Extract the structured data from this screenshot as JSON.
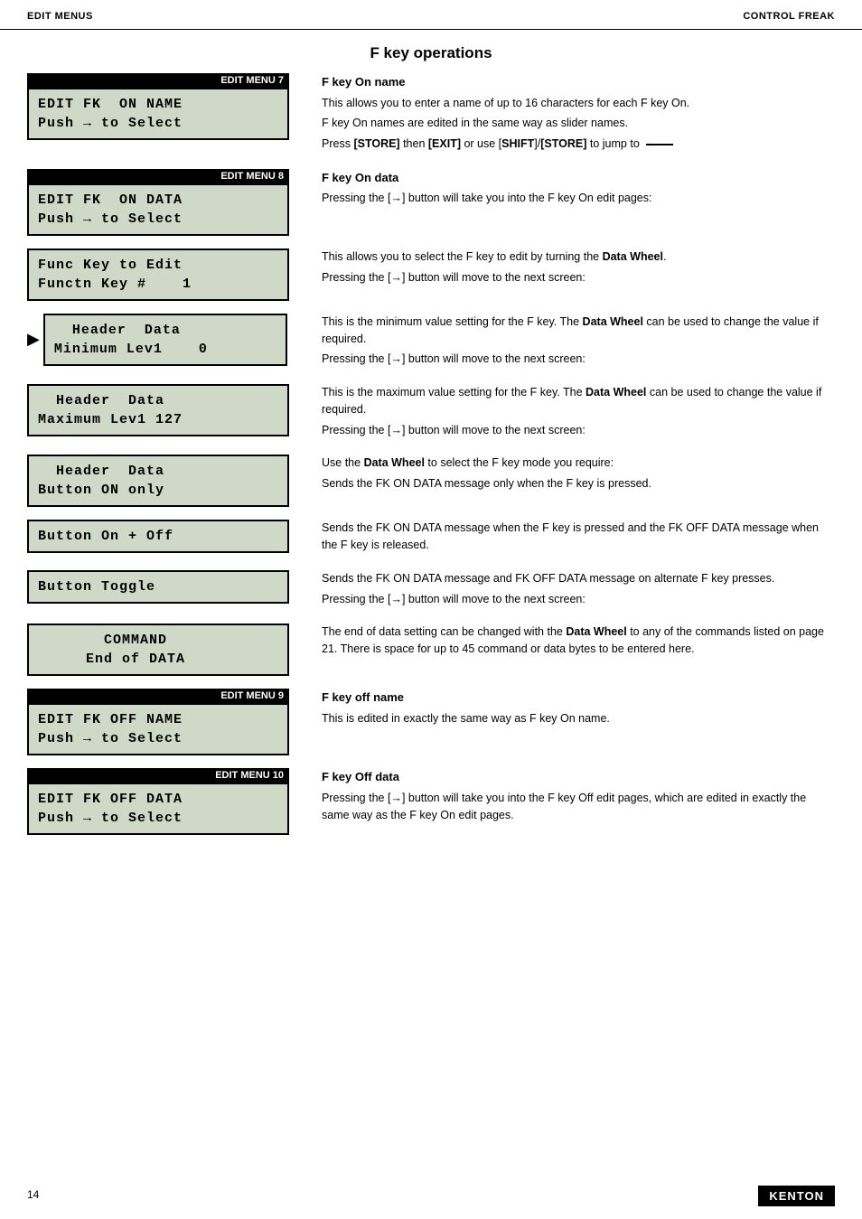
{
  "header": {
    "left": "EDIT MENUS",
    "right": "CONTROL FREAK"
  },
  "section_title": "F key operations",
  "page_number": "14",
  "brand": "KENTON",
  "rows": [
    {
      "id": "edit-menu-7",
      "menu_label": "EDIT MENU 7",
      "lcd_lines": [
        "EDIT FK  ON NAME",
        "Push → to Select"
      ],
      "heading": "F key On name",
      "has_pointer": false,
      "paragraphs": [
        "This allows you to enter a name of up to 16 characters for each F key On.",
        "F key On names are edited in the same way as slider names.",
        "Press [STORE] then [EXIT] or use [SHIFT]/[STORE] to jump to —"
      ]
    },
    {
      "id": "edit-menu-8",
      "menu_label": "EDIT MENU 8",
      "lcd_lines": [
        "EDIT FK  ON DATA",
        "Push → to Select"
      ],
      "heading": "F key On data",
      "has_pointer": false,
      "paragraphs": [
        "Pressing the [→] button will take you into the F key On edit pages:"
      ]
    },
    {
      "id": "func-key-edit",
      "menu_label": null,
      "lcd_lines": [
        "Func Key to Edit",
        "Functn Key #    1"
      ],
      "heading": null,
      "has_pointer": false,
      "paragraphs": [
        "This allows you to select the F key to edit by turning the Data Wheel.",
        "Pressing the [→] button will move to the next screen:"
      ]
    },
    {
      "id": "header-data-min",
      "menu_label": null,
      "lcd_lines": [
        "  Header  Data  ",
        "Minimum Lev1    0"
      ],
      "heading": null,
      "has_pointer": true,
      "paragraphs": [
        "This is the minimum value setting for the F key. The Data Wheel can be used to change the value if required.",
        "Pressing the [→] button will move to the next screen:"
      ]
    },
    {
      "id": "header-data-max",
      "menu_label": null,
      "lcd_lines": [
        "  Header  Data  ",
        "Maximum Lev1 127"
      ],
      "heading": null,
      "has_pointer": false,
      "paragraphs": [
        "This is the maximum value setting for the F key. The Data Wheel can be used to change the value if required.",
        "Pressing the [→] button will move to the next screen:"
      ]
    },
    {
      "id": "header-data-button-on",
      "menu_label": null,
      "lcd_lines": [
        "  Header  Data  ",
        "Button ON only  "
      ],
      "heading": null,
      "has_pointer": false,
      "paragraphs": [
        "Use the Data Wheel to select the F key mode you require:",
        "Sends the FK ON DATA message only when the F key is pressed."
      ]
    },
    {
      "id": "button-on-off",
      "menu_label": null,
      "lcd_lines": [
        "Button On + Off "
      ],
      "heading": null,
      "has_pointer": false,
      "paragraphs": [
        "Sends the FK ON DATA message when the F key is pressed and the FK OFF DATA message when the F key is released."
      ]
    },
    {
      "id": "button-toggle",
      "menu_label": null,
      "lcd_lines": [
        "Button Toggle   "
      ],
      "heading": null,
      "has_pointer": false,
      "paragraphs": [
        "Sends the FK ON DATA message and FK OFF DATA message on alternate F key presses.",
        "Pressing the [→] button will move to the next screen:"
      ]
    },
    {
      "id": "command-end-data",
      "menu_label": null,
      "lcd_lines": [
        "  COMMAND       ",
        "End of DATA     "
      ],
      "heading": null,
      "has_pointer": false,
      "paragraphs": [
        "The end of data setting can be changed with the Data Wheel to any of the commands listed on page 21. There is space for up to 45 command or data bytes to be entered here."
      ]
    },
    {
      "id": "edit-menu-9",
      "menu_label": "EDIT MENU 9",
      "lcd_lines": [
        "EDIT FK  OFF NAME",
        "Push → to Select"
      ],
      "heading": "F key off name",
      "has_pointer": false,
      "paragraphs": [
        "This is edited in exactly the same way as F key On name."
      ]
    },
    {
      "id": "edit-menu-10",
      "menu_label": "EDIT MENU 10",
      "lcd_lines": [
        "EDIT FK  OFF DATA",
        "Push → to Select"
      ],
      "heading": "F key Off data",
      "has_pointer": false,
      "paragraphs": [
        "Pressing the [→] button will take you into the F key Off edit pages, which are edited in exactly the same way as the F key On edit pages."
      ]
    }
  ]
}
